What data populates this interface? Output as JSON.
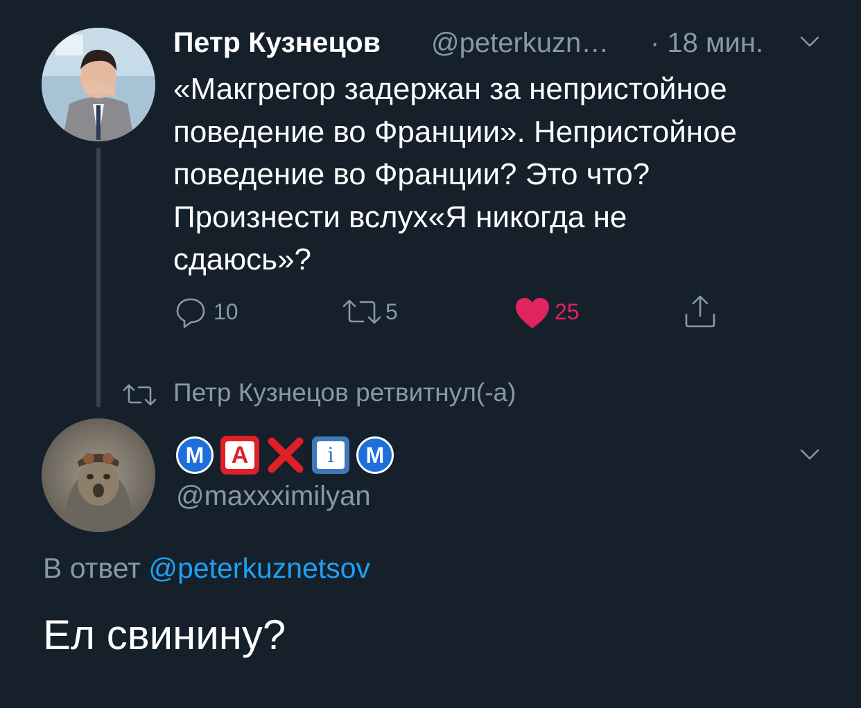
{
  "original_tweet": {
    "author_name": "Петр Кузнецов",
    "author_handle": "@peterkuzn…",
    "time": "· 18 мин.",
    "text_lines": [
      "«Макгрегор задержан за непристойное",
      "поведение во Франции». Непристойное",
      "поведение во Франции? Это что?",
      "Произнести вслух«Я никогда не",
      "сдаюсь»?"
    ],
    "actions": {
      "replies": "10",
      "retweets": "5",
      "likes": "25"
    }
  },
  "retweet_banner": {
    "label": "Петр Кузнецов ретвитнул(-а)"
  },
  "reply_tweet": {
    "display_name_emoji": [
      "M",
      "A",
      "X",
      "i",
      "M"
    ],
    "handle": "@maxxximilyan",
    "reply_to_prefix": "В ответ",
    "reply_to_handle": "@peterkuznetsov",
    "text": "Ел свинину?"
  },
  "colors": {
    "background": "#15202b",
    "secondary_text": "#8899a6",
    "link": "#1da1f2",
    "like": "#e0245e",
    "thread_line": "#38444d"
  },
  "icons": [
    "reply-icon",
    "retweet-icon",
    "heart-icon",
    "share-icon",
    "chevron-down-icon"
  ]
}
